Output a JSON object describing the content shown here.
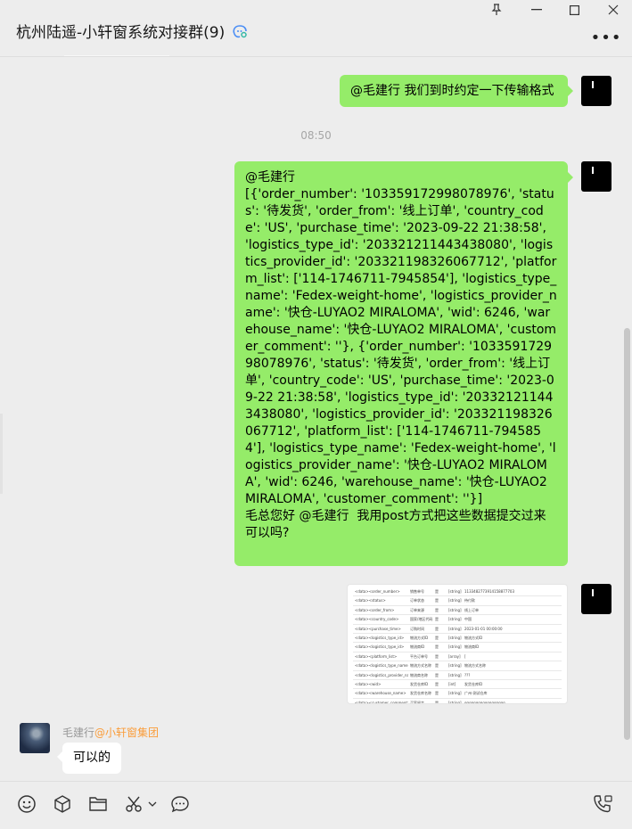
{
  "header": {
    "title": "杭州陆遥-小轩窗系统对接群(9)",
    "window_controls": {
      "pin_icon": "pin-icon",
      "minimize_icon": "minimize-icon",
      "maximize_icon": "maximize-icon",
      "close_icon": "close-icon"
    },
    "more_label": "•••"
  },
  "messages": [
    {
      "side": "right",
      "text": "@毛建行  我们到时约定一下传输格式"
    },
    {
      "type": "time",
      "text": "08:50"
    },
    {
      "side": "right",
      "text": "@毛建行\n[{'order_number': '103359172998078976', 'status': '待发货', 'order_from': '线上订单', 'country_code': 'US', 'purchase_time': '2023-09-22 21:38:58', 'logistics_type_id': '203321211443438080', 'logistics_provider_id': '203321198326067712', 'platform_list': ['114-1746711-7945854'], 'logistics_type_name': 'Fedex-weight-home', 'logistics_provider_name': '快仓-LUYAO2 MIRALOMA', 'wid': 6246, 'warehouse_name': '快仓-LUYAO2 MIRALOMA', 'customer_comment': ''}, {'order_number': '103359172998078976', 'status': '待发货', 'order_from': '线上订单', 'country_code': 'US', 'purchase_time': '2023-09-22 21:38:58', 'logistics_type_id': '203321211443438080', 'logistics_provider_id': '203321198326067712', 'platform_list': ['114-1746711-7945854'], 'logistics_type_name': 'Fedex-weight-home', 'logistics_provider_name': '快仓-LUYAO2 MIRALOMA', 'wid': 6246, 'warehouse_name': '快仓-LUYAO2 MIRALOMA', 'customer_comment': ''}]\n毛总您好 @毛建行  我用post方式把这些数据提交过来可以吗?"
    },
    {
      "side": "right",
      "type": "image",
      "table_rows": [
        [
          "<data><order_number>",
          "销售单号",
          "是",
          "[string]",
          "1133482773914158877703"
        ],
        [
          "<data><status>",
          "订单状态",
          "是",
          "[string]",
          "待付款"
        ],
        [
          "<data><order_from>",
          "订单来源",
          "是",
          "[string]",
          "线上订单"
        ],
        [
          "<data><country_code>",
          "国家/地区代码",
          "是",
          "[string]",
          "中国"
        ],
        [
          "<data><purchase_time>",
          "订购时间",
          "是",
          "[string]",
          "2023-01-01 00:00:00"
        ],
        [
          "<data><logistics_type_id>",
          "物流方式ID",
          "是",
          "[string]",
          "物流方式ID"
        ],
        [
          "<data><logistics_type_id>",
          "物流商ID",
          "是",
          "[string]",
          "物流商ID"
        ],
        [
          "<data><platform_list>",
          "平台订单号",
          "是",
          "[array]",
          "["
        ],
        [
          "<data><logistics_type_name>",
          "物流方式名称",
          "是",
          "[string]",
          "物流方式名称"
        ],
        [
          "<data><logistics_provider_name>",
          "物流商名称",
          "是",
          "[string]",
          "???"
        ],
        [
          "<data><wid>",
          "发货仓库ID",
          "是",
          "[int]",
          "发货仓库ID"
        ],
        [
          "<data><warehouse_name>",
          "发货仓库名称",
          "是",
          "[string]",
          "广州-测试仓库"
        ],
        [
          "<data><customer_comment>",
          "买家留言",
          "是",
          "[string]",
          "qqqqqqqqqqqqqqqqqq"
        ]
      ]
    },
    {
      "side": "left",
      "sender_name": "毛建行",
      "sender_org": "@小轩窗集团",
      "text": "可以的"
    }
  ],
  "toolbar": {
    "emoji_icon": "emoji-icon",
    "favorites_icon": "cube-icon",
    "file_icon": "folder-icon",
    "screenshot_icon": "scissors-icon",
    "screenshot_menu_icon": "chevron-down-icon",
    "chat_history_icon": "chat-bubble-icon",
    "call_icon": "phone-icon"
  }
}
